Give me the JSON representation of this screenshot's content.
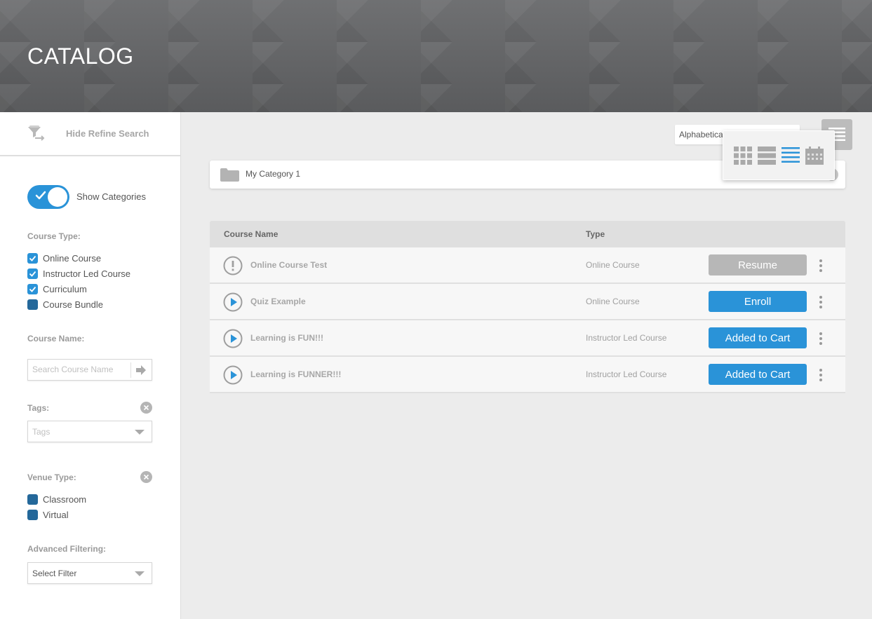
{
  "header": {
    "title": "CATALOG"
  },
  "sidebar": {
    "refine_label": "Hide Refine Search",
    "show_categories_label": "Show Categories",
    "course_type_label": "Course Type:",
    "course_types": [
      {
        "label": "Online Course",
        "checked": true
      },
      {
        "label": "Instructor Led Course",
        "checked": true
      },
      {
        "label": "Curriculum",
        "checked": true
      },
      {
        "label": "Course Bundle",
        "checked": false
      }
    ],
    "course_name_label": "Course Name:",
    "search_placeholder": "Search Course Name",
    "tags_label": "Tags:",
    "tags_placeholder": "Tags",
    "venue_type_label": "Venue Type:",
    "venues": [
      {
        "label": "Classroom",
        "checked": false
      },
      {
        "label": "Virtual",
        "checked": false
      }
    ],
    "advanced_label": "Advanced Filtering:",
    "advanced_value": "Select Filter"
  },
  "main": {
    "sort_value": "Alphabetica",
    "category_label": "My Category 1",
    "table": {
      "headers": {
        "name": "Course Name",
        "type": "Type"
      },
      "rows": [
        {
          "name": "Online Course Test",
          "type": "Online Course",
          "button": "Resume",
          "icon": "alert-icon"
        },
        {
          "name": "Quiz Example",
          "type": "Online Course",
          "button": "Enroll",
          "icon": "play-icon"
        },
        {
          "name": "Learning is FUN!!!",
          "type": "Instructor Led Course",
          "button": "Added to Cart",
          "icon": "play-icon"
        },
        {
          "name": "Learning is FUNNER!!!",
          "type": "Instructor Led Course",
          "button": "Added to Cart",
          "icon": "play-icon"
        }
      ]
    }
  },
  "colors": {
    "accent": "#2a93d8",
    "dark_check": "#24689a",
    "disabled_button": "#b7b7b7"
  }
}
